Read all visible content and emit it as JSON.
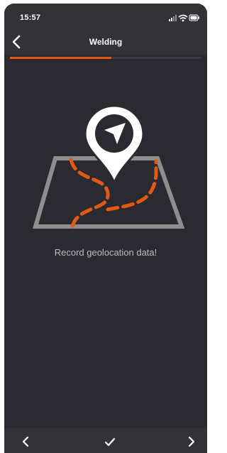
{
  "status_bar": {
    "time": "15:57",
    "icons": [
      "cellular-signal-icon",
      "wifi-icon",
      "battery-icon"
    ]
  },
  "header": {
    "title": "Welding",
    "back_icon": "chevron-left-icon"
  },
  "progress": {
    "fraction": 0.53,
    "color": "#e05a14"
  },
  "main": {
    "illustration_icon": "map-location-pin-icon",
    "message": "Record geolocation data!"
  },
  "footer": {
    "buttons": [
      "previous-chevron-icon",
      "checkmark-icon",
      "next-chevron-icon"
    ]
  },
  "colors": {
    "background": "#2b2a30",
    "bar": "#333237",
    "accent": "#e05a14",
    "text_muted": "#bdbcc2"
  }
}
